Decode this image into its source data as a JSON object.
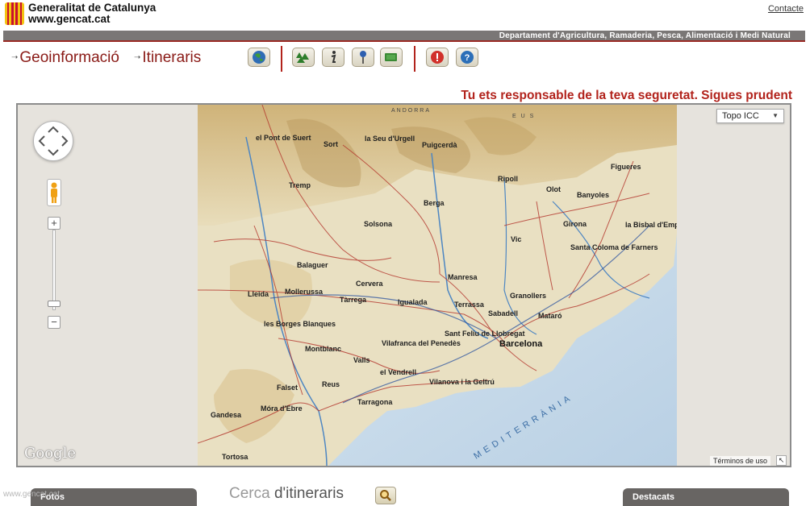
{
  "header": {
    "org_name": "Generalitat de Catalunya",
    "org_url": "www.gencat.cat",
    "contact_label": "Contacte",
    "department": "Departament d'Agricultura, Ramaderia, Pesca, Alimentació i Medi Natural"
  },
  "nav": {
    "geoinfo_label": "Geoinformació",
    "itineraris_label": "Itineraris"
  },
  "toolbar": {
    "icons": [
      "globe-icon",
      "forest-icon",
      "info-icon",
      "location-pin-icon",
      "layers-icon",
      "alert-icon",
      "help-icon"
    ]
  },
  "warning_text": "Tu ets responsable de la teva seguretat. Sigues prudent",
  "map": {
    "map_type": "Topo ICC",
    "terms_label": "Términos de uso",
    "provider": "Google",
    "towns": [
      "el Pont de Suert",
      "Sort",
      "la Seu d'Urgell",
      "Puigcerdà",
      "Tremp",
      "Ripoll",
      "Olot",
      "Figueres",
      "Banyoles",
      "Berga",
      "Solsona",
      "Girona",
      "la Bisbal d'Empordà",
      "Vic",
      "Santa Coloma de Farners",
      "Balaguer",
      "Manresa",
      "Lleida",
      "Mollerussa",
      "Cervera",
      "Tàrrega",
      "Granollers",
      "Igualada",
      "Terrassa",
      "Sabadell",
      "Mataró",
      "les Borges Blanques",
      "Sant Feliu de Llobregat",
      "Barcelona",
      "Vilafranca del Penedès",
      "Montblanc",
      "Valls",
      "el Vendrell",
      "Vilanova i la Geltrú",
      "Reus",
      "Falset",
      "Tarragona",
      "Móra d'Ebre",
      "Gandesa",
      "Tortosa"
    ],
    "sea_label": "MEDITERRÀNIA",
    "region_labels": [
      "ANDORRA",
      "E U S"
    ]
  },
  "bottom": {
    "photos_label": "Fotos",
    "search_label_light": "Cerca",
    "search_label_strong": "d'itineraris",
    "featured_label": "Destacats",
    "footer_url": "www.gencat.cat"
  },
  "colors": {
    "brand_red": "#b2231c",
    "bar_gray": "#7a7776",
    "sea_blue": "#c6d9ea",
    "terrain": "#e7d9b4"
  }
}
